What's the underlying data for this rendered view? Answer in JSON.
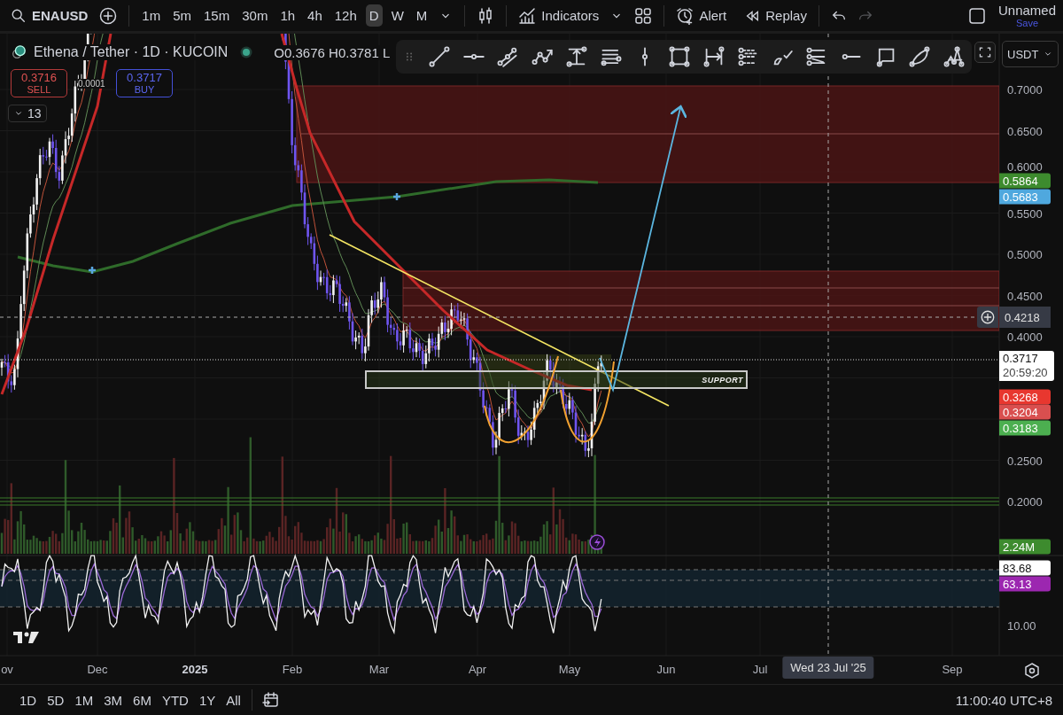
{
  "toolbar": {
    "symbol": "ENAUSD",
    "intervals": [
      {
        "label": "1m",
        "selected": false
      },
      {
        "label": "5m",
        "selected": false
      },
      {
        "label": "15m",
        "selected": false
      },
      {
        "label": "30m",
        "selected": false
      },
      {
        "label": "1h",
        "selected": false
      },
      {
        "label": "4h",
        "selected": false
      },
      {
        "label": "12h",
        "selected": false
      },
      {
        "label": "D",
        "selected": true
      },
      {
        "label": "W",
        "selected": false
      },
      {
        "label": "M",
        "selected": false
      }
    ],
    "indicators": "Indicators",
    "alert": "Alert",
    "replay": "Replay",
    "undo": {
      "disabled": false
    },
    "redo": {
      "disabled": true
    },
    "layout": {
      "name": "Unnamed",
      "save": "Save"
    }
  },
  "legend": {
    "title": "Ethena / Tether · 1D · KUCOIN",
    "ohlc": "O0.3676 H0.3781 L",
    "sell": {
      "price": "0.3716",
      "label": "SELL"
    },
    "spread": "0.0001",
    "buy": {
      "price": "0.3717",
      "label": "BUY"
    },
    "indicator_count": "13"
  },
  "currency": "USDT",
  "price_axis": [
    "0.7000",
    "0.6500",
    "0.6000",
    "0.5500",
    "0.5000",
    "0.4500",
    "0.4000",
    "0.2500",
    "0.2000"
  ],
  "price_badges": [
    {
      "text": "0.5864",
      "color": "#3d8b2e"
    },
    {
      "text": "0.5683",
      "color": "#4fa8de"
    },
    {
      "text": "0.3268",
      "color": "#e8372f"
    },
    {
      "text": "0.3204",
      "color": "#d94f4f"
    },
    {
      "text": "0.3183",
      "color": "#4caf50"
    },
    {
      "text": "2.24M",
      "color": "#3d8b2e"
    }
  ],
  "crosshair_price": "0.4218",
  "last_price": {
    "price": "0.3717",
    "countdown": "20:59:20"
  },
  "annotation": "SUPPORT",
  "oscillator": {
    "axis": [
      "10.00"
    ],
    "badges": [
      {
        "text": "83.68",
        "color": "#ffffff"
      },
      {
        "text": "63.13",
        "color": "#9c27b0"
      }
    ]
  },
  "time_axis": [
    {
      "label": "ov",
      "kind": "month"
    },
    {
      "label": "Dec",
      "kind": "month"
    },
    {
      "label": "2025",
      "kind": "year"
    },
    {
      "label": "Feb",
      "kind": "month"
    },
    {
      "label": "Mar",
      "kind": "month"
    },
    {
      "label": "Apr",
      "kind": "month"
    },
    {
      "label": "May",
      "kind": "month"
    },
    {
      "label": "Jun",
      "kind": "month"
    },
    {
      "label": "Jul",
      "kind": "month"
    },
    {
      "label": "Sep",
      "kind": "month"
    }
  ],
  "crosshair_date": "Wed 23 Jul '25",
  "ranges": [
    {
      "label": "1D",
      "selected": false
    },
    {
      "label": "5D",
      "selected": false
    },
    {
      "label": "1M",
      "selected": false
    },
    {
      "label": "3M",
      "selected": false
    },
    {
      "label": "6M",
      "selected": false
    },
    {
      "label": "YTD",
      "selected": false
    },
    {
      "label": "1Y",
      "selected": false
    },
    {
      "label": "All",
      "selected": false
    }
  ],
  "clock": "11:00:40 UTC+8"
}
